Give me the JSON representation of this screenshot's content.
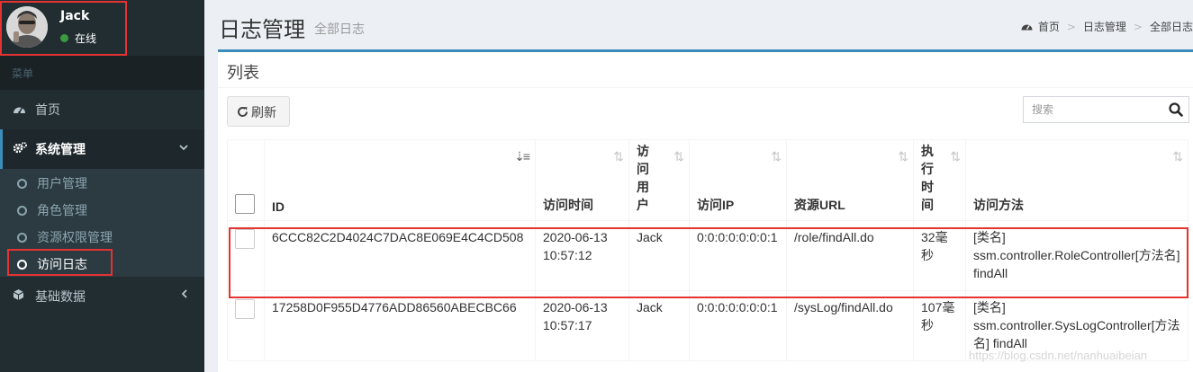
{
  "user": {
    "name": "Jack",
    "status": "在线"
  },
  "sidebar": {
    "header": "菜单",
    "items": [
      {
        "label": "首页",
        "icon": "dashboard-icon"
      },
      {
        "label": "系统管理",
        "icon": "cogs-icon",
        "expanded": true
      },
      {
        "label": "基础数据",
        "icon": "cube-icon"
      }
    ],
    "subitems": [
      {
        "label": "用户管理"
      },
      {
        "label": "角色管理"
      },
      {
        "label": "资源权限管理"
      },
      {
        "label": "访问日志"
      }
    ]
  },
  "header": {
    "title": "日志管理",
    "subtitle": "全部日志",
    "breadcrumb": [
      "首页",
      "日志管理",
      "全部日志"
    ]
  },
  "box": {
    "title": "列表",
    "refresh_label": "刷新",
    "search_placeholder": "搜索"
  },
  "table": {
    "columns": [
      "ID",
      "访问时间",
      "访问用户",
      "访问IP",
      "资源URL",
      "执行时间",
      "访问方法"
    ],
    "rows": [
      {
        "id": "6CCC82C2D4024C7DAC8E069E4C4CD508",
        "time": "2020-06-13 10:57:12",
        "user": "Jack",
        "ip": "0:0:0:0:0:0:0:1",
        "url": "/role/findAll.do",
        "exec": "32毫秒",
        "method": "[类名] ssm.controller.RoleController[方法名] findAll"
      },
      {
        "id": "17258D0F955D4776ADD86560ABECBC66",
        "time": "2020-06-13 10:57:17",
        "user": "Jack",
        "ip": "0:0:0:0:0:0:0:1",
        "url": "/sysLog/findAll.do",
        "exec": "107毫秒",
        "method": "[类名] ssm.controller.SysLogController[方法名] findAll"
      }
    ]
  },
  "watermark": "https://blog.csdn.net/nanhuaibeian",
  "colors": {
    "sidebar": "#222d32",
    "accent": "#3c8dbc",
    "highlight": "#e53232",
    "online": "#3c9a3f"
  }
}
